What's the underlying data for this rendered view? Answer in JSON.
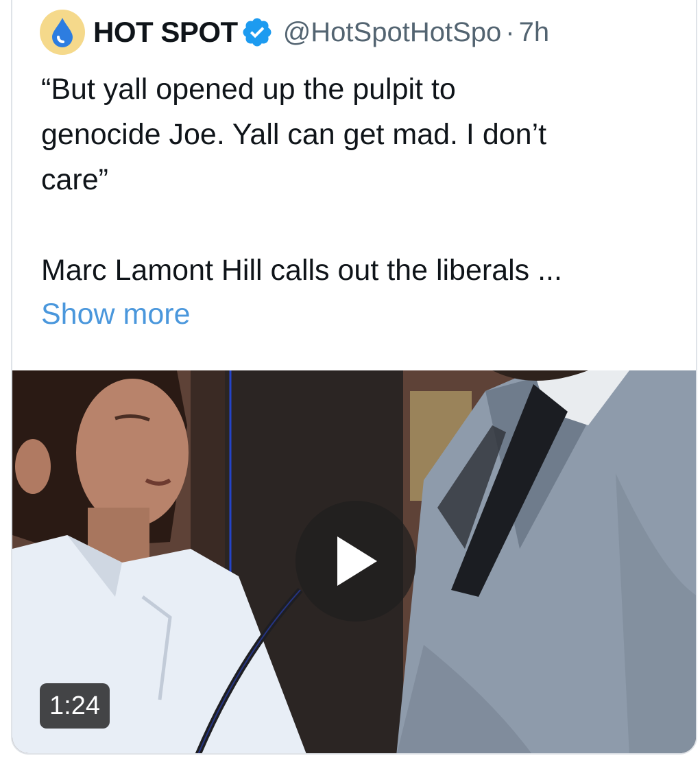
{
  "tweet": {
    "author_name": "HOT SPOT",
    "handle": "@HotSpotHotSpo",
    "separator": "·",
    "time": "7h",
    "verified_icon": "verified-badge-icon",
    "avatar_icon": "water-drop-icon",
    "text": "“But yall opened up the pulpit to\ngenocide Joe. Yall can get mad. I don’t\ncare”\n\nMarc Lamont Hill calls out the liberals ...",
    "show_more": "Show more"
  },
  "video": {
    "duration": "1:24",
    "play_icon": "play-icon"
  },
  "colors": {
    "link": "#4a97dc",
    "verified": "#1d9bf0",
    "secondary_text": "#536471"
  }
}
